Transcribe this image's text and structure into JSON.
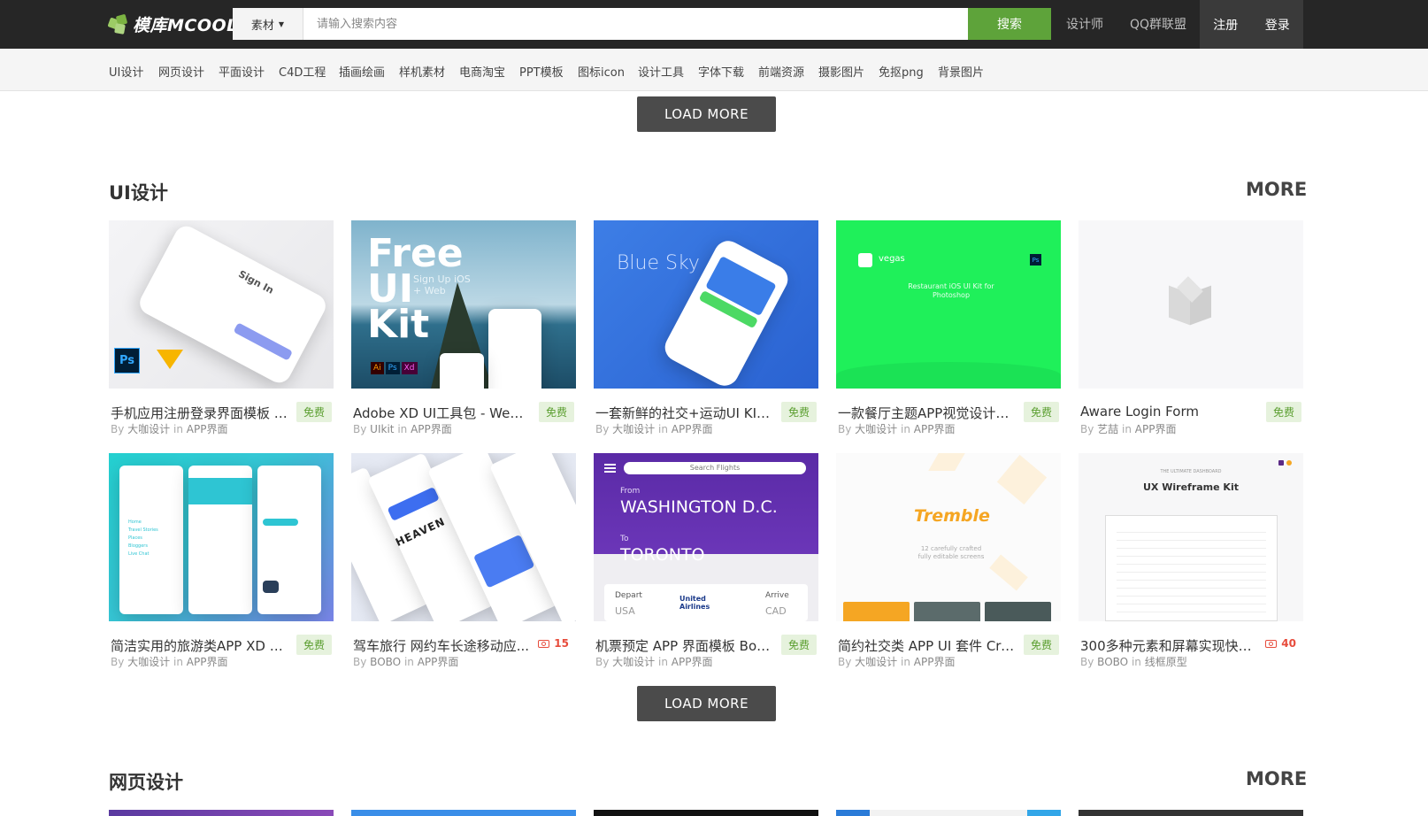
{
  "brand": {
    "logo_text": "模库MCOOL"
  },
  "search": {
    "category": "素材",
    "placeholder": "请输入搜索内容",
    "button": "搜索"
  },
  "top_links": [
    "设计师",
    "QQ群联盟"
  ],
  "auth": {
    "register": "注册",
    "login": "登录"
  },
  "subnav": [
    "UI设计",
    "网页设计",
    "平面设计",
    "C4D工程",
    "插画绘画",
    "样机素材",
    "电商淘宝",
    "PPT模板",
    "图标icon",
    "设计工具",
    "字体下载",
    "前端资源",
    "摄影图片",
    "免抠png",
    "背景图片"
  ],
  "load_more": "LOAD MORE",
  "sections": [
    {
      "title": "UI设计",
      "more": "MORE"
    },
    {
      "title": "网页设计",
      "more": "MORE"
    }
  ],
  "cards": [
    {
      "title": "手机应用注册登录界面模板 M...",
      "author": "大咖设计",
      "category": "APP界面",
      "badge": "免费",
      "thumb_text": "Sign In",
      "thumb_chips": [
        "Ps"
      ]
    },
    {
      "title": "Adobe XD UI工具包 - Web...",
      "author": "UIkit",
      "category": "APP界面",
      "badge": "免费",
      "thumb_text": "Free UI Kit",
      "thumb_sub": "Sign Up iOS + Web",
      "thumb_chips": [
        "Ai",
        "Ps",
        "Xd"
      ]
    },
    {
      "title": "一套新鲜的社交+运动UI KITS...",
      "author": "大咖设计",
      "category": "APP界面",
      "badge": "免费",
      "thumb_text": "Blue Sky"
    },
    {
      "title": "一款餐厅主题APP视觉设计模...",
      "author": "大咖设计",
      "category": "APP界面",
      "badge": "免费",
      "thumb_text": "vegas",
      "thumb_sub": "Restaurant iOS UI Kit for Photoshop",
      "thumb_chips": [
        "Ps"
      ]
    },
    {
      "title": "Aware Login Form",
      "author": "艺喆",
      "category": "APP界面",
      "badge": "免费"
    },
    {
      "title": "简洁实用的旅游类APP XD UI ...",
      "author": "大咖设计",
      "category": "APP界面",
      "badge": "免费",
      "thumb_items": [
        "Home",
        "Travel Stories",
        "Places",
        "Bloggers",
        "Live Chat"
      ]
    },
    {
      "title": "驾车旅行 网约车长途移动应...",
      "author": "BOBO",
      "category": "APP界面",
      "badge": "",
      "price": "15",
      "thumb_text": "HEAVEN"
    },
    {
      "title": "机票预定 APP 界面模板 Book...",
      "author": "大咖设计",
      "category": "APP界面",
      "badge": "免费",
      "thumb_search": "Search Flights",
      "thumb_from_label": "From",
      "thumb_from": "WASHINGTON D.C.",
      "thumb_to_label": "To",
      "thumb_to": "TORONTO",
      "thumb_depart": "Depart",
      "thumb_arrive": "Arrive",
      "thumb_airline": "United Airlines",
      "thumb_codes": [
        "USA",
        "CAD"
      ]
    },
    {
      "title": "简约社交类 APP UI 套件 Crea...",
      "author": "大咖设计",
      "category": "APP界面",
      "badge": "免费",
      "thumb_text": "Tremble",
      "thumb_sub": "12 carefully crafted fully editable screens"
    },
    {
      "title": "300多种元素和屏幕实现快速...",
      "author": "BOBO",
      "category": "线框原型",
      "badge": "",
      "price": "40",
      "thumb_text": "UX Wireframe Kit",
      "thumb_sub": "THE ULTIMATE DASHBOARD"
    }
  ],
  "meta_labels": {
    "by": "By",
    "in": "in"
  },
  "colors": {
    "topbar": "#262626",
    "accent_green": "#5ea33a",
    "price_red": "#e74c3c"
  }
}
